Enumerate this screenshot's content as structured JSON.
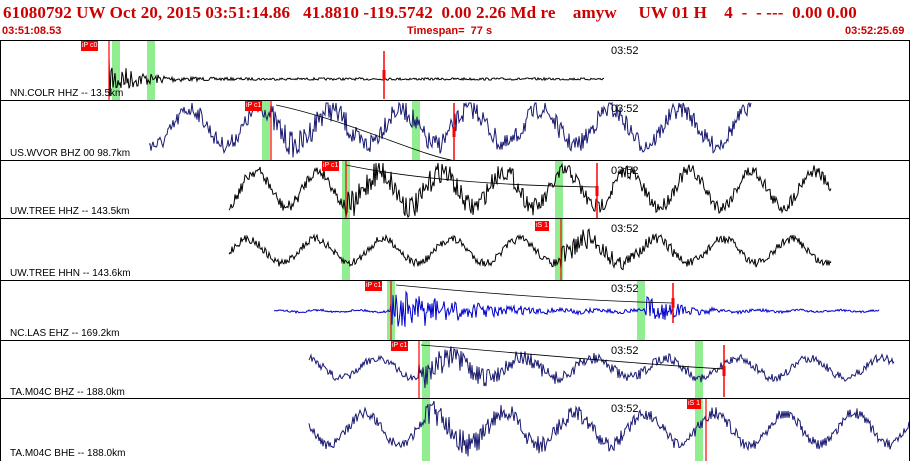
{
  "header": {
    "title": "61080792 UW Oct 20, 2015 03:51:14.86   41.8810 -119.5742  0.00 2.26 Md re    amyw     UW 01 H    4  -  - ---  0.00 0.00",
    "start_time": "03:51:08.53",
    "timespan": "Timespan=  77 s",
    "end_time": "03:52:25.69"
  },
  "colors": {
    "header_text": "#cc0000",
    "pick_flag": "#ff0000",
    "window_marker": "#90ee90",
    "trace_dark_blue": "#191970",
    "trace_black": "#000000",
    "trace_blue": "#0000cc"
  },
  "panels": [
    {
      "station": "NN.COLR HHZ -- 13.5km",
      "tick": "03:52",
      "pick": "iP c0",
      "color": "#000000"
    },
    {
      "station": "US.WVOR BHZ 00 98.7km",
      "tick": "03:52",
      "pick": "iP c1",
      "color": "#191970"
    },
    {
      "station": "UW.TREE HHZ -- 143.5km",
      "tick": "03:52",
      "pick": "iP c1",
      "color": "#000000"
    },
    {
      "station": "UW.TREE HHN -- 143.6km",
      "tick": "03:52",
      "pick": "iS 1",
      "color": "#000000"
    },
    {
      "station": "NC.LAS EHZ -- 169.2km",
      "tick": "03:52",
      "pick": "iP c1",
      "color": "#0000cc"
    },
    {
      "station": "TA.M04C BHZ -- 188.0km",
      "tick": "03:52",
      "pick": "iP c1",
      "color": "#191970"
    },
    {
      "station": "TA.M04C BHE -- 188.0km",
      "tick": "03:52",
      "pick": "iS 1",
      "color": "#191970"
    }
  ]
}
